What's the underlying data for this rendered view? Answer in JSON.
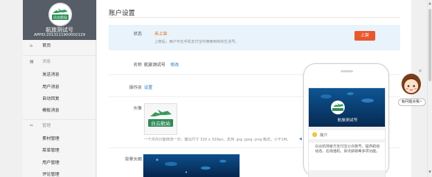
{
  "sidebar": {
    "account_name": "航旅测试号",
    "appid": "APPID:2013111900002129",
    "logo_text": "白云航站",
    "items": [
      {
        "icon": "home-icon",
        "label": "首页",
        "group": false
      },
      {
        "icon": "message-icon",
        "label": "消息",
        "group": true
      },
      {
        "icon": "",
        "label": "发送消息",
        "group": false
      },
      {
        "icon": "",
        "label": "用户消息",
        "group": false
      },
      {
        "icon": "",
        "label": "自动回复",
        "group": false
      },
      {
        "icon": "",
        "label": "模板消息",
        "group": false
      },
      {
        "icon": "tools-icon",
        "label": "管理",
        "group": true
      },
      {
        "icon": "",
        "label": "素材管理",
        "group": false
      },
      {
        "icon": "",
        "label": "菜单管理",
        "group": false
      },
      {
        "icon": "",
        "label": "用户管理",
        "group": false
      },
      {
        "icon": "",
        "label": "评论管理",
        "group": false
      }
    ]
  },
  "main": {
    "title": "账户设置",
    "status": {
      "label": "状态",
      "value": "未上架",
      "description": "上架后，用户可在手机支付宝中搜索到你的生活号。",
      "button": "上架"
    },
    "name": {
      "label": "名称",
      "value": "航旅测试号",
      "edit_link": "修改"
    },
    "operator": {
      "label": "操作员",
      "link": "设置"
    },
    "avatar": {
      "label": "头像",
      "logo_text": "白云航站",
      "hint": "一个月内只能修改一次，建议尺寸 320 x 320px，支持 .jpg .jpeg .png 格式，小于1M。"
    },
    "background": {
      "label": "背景头图"
    }
  },
  "preview": {
    "name": "航旅测试号",
    "intro_label": "简介",
    "description": "白云机场官方支付宝公众账号，提供航班动态、在线值机、资讯获取等多项功能。"
  },
  "helper": {
    "label": "有问题点我~",
    "close": "×"
  },
  "colors": {
    "accent": "#2d7ac6",
    "status_orange": "#e46b1c",
    "button_red": "#e9582d",
    "sidebar_header": "#565d66",
    "status_bg": "#e9f3fb",
    "brand_green": "#2e8b57"
  }
}
